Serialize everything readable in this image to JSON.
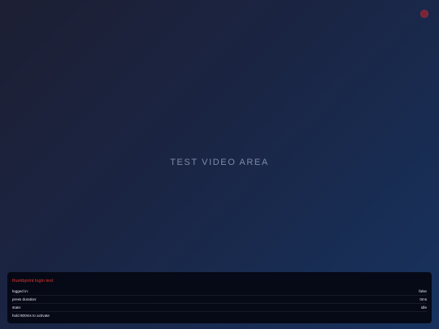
{
  "video": {
    "label": "TEST VIDEO AREA"
  },
  "indicator": {
    "name": "record-indicator",
    "color": "#7a2435"
  },
  "debug_panel": {
    "title": "thumbprint login test",
    "title_color": "#e0362f",
    "rows": [
      {
        "label": "logged in:",
        "value": "false"
      },
      {
        "label": "press duration:",
        "value": "0ms"
      },
      {
        "label": "state:",
        "value": "idle"
      }
    ],
    "hint": "hold 800ms to activate"
  }
}
